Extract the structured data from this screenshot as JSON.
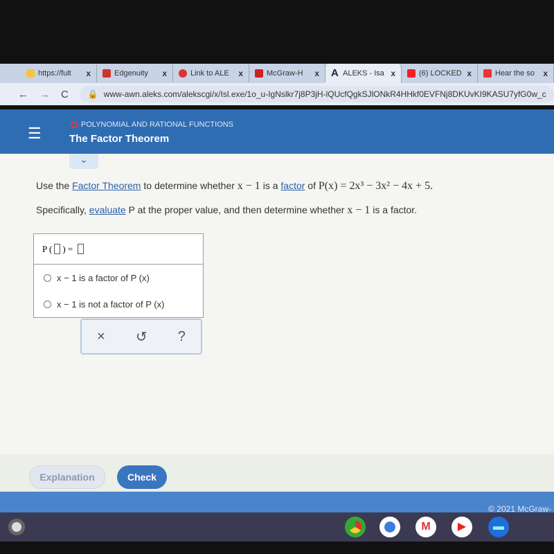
{
  "browser": {
    "tabs": [
      {
        "label": "https://fult",
        "color": "#f5c542"
      },
      {
        "label": "Edgenuity",
        "color": "#c33"
      },
      {
        "label": "Link to ALE",
        "color": "#d33"
      },
      {
        "label": "McGraw-H",
        "color": "#c22"
      },
      {
        "label": "ALEKS - Isa",
        "color": "#224"
      },
      {
        "label": "(6) LOCKED",
        "color": "#e22"
      },
      {
        "label": "Hear the so",
        "color": "#e33"
      }
    ],
    "close_glyph": "x",
    "url": "www-awn.aleks.com/alekscgi/x/Isl.exe/1o_u-IgNslkr7j8P3jH-lQUcfQgkSJlONkR4HHkf0EVFNj8DKUvKI9KASU7yfG0w_c"
  },
  "header": {
    "topic": "POLYNOMIAL AND RATIONAL FUNCTIONS",
    "title": "The Factor Theorem",
    "menu_glyph": "☰"
  },
  "question": {
    "p1_a": "Use the ",
    "link1": "Factor Theorem",
    "p1_b": " to determine whether ",
    "expr1": "x − 1",
    "p1_c": " is a ",
    "link2": "factor",
    "p1_d": " of ",
    "poly": "P(x) = 2x³ − 3x² − 4x + 5.",
    "p2_a": "Specifically, ",
    "link3": "evaluate",
    "p2_b": " P at the proper value, and then determine whether ",
    "expr2": "x − 1",
    "p2_c": " is a factor."
  },
  "answer": {
    "eval_prefix": "P (",
    "eval_suffix": ") =",
    "options": [
      "x − 1 is a factor of P (x)",
      "x − 1 is not a factor of P (x)"
    ]
  },
  "tools": {
    "clear": "×",
    "undo": "↺",
    "help": "?"
  },
  "footer": {
    "explanation": "Explanation",
    "check": "Check",
    "copyright": "© 2021 McGraw-"
  }
}
